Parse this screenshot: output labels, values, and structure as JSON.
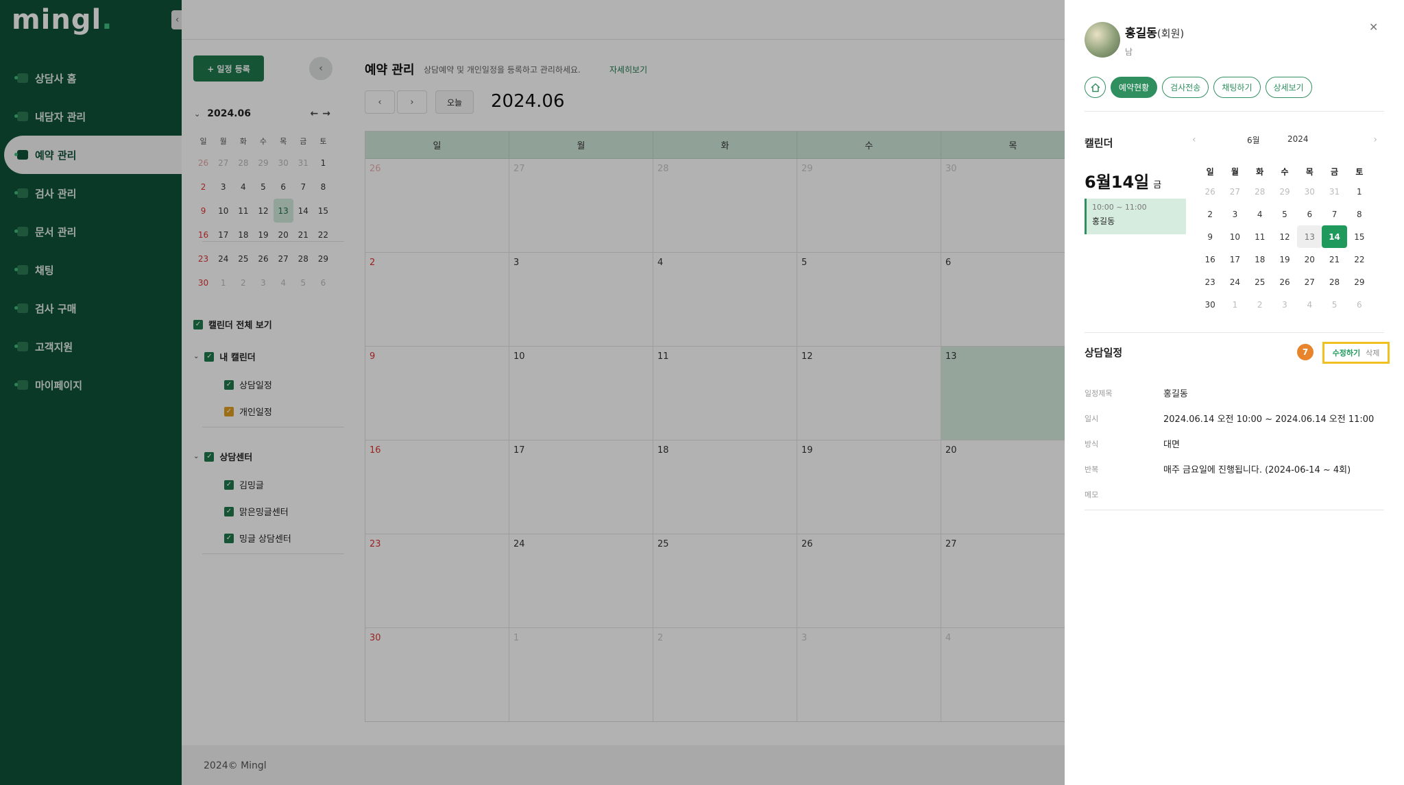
{
  "app": {
    "logo": "mingl",
    "logo_dot": "."
  },
  "sidebar": {
    "collapse_icon": "‹",
    "items": [
      {
        "label": "상담사 홈",
        "active": false
      },
      {
        "label": "내담자 관리",
        "active": false
      },
      {
        "label": "예약 관리",
        "active": true
      },
      {
        "label": "검사 관리",
        "active": false
      },
      {
        "label": "문서 관리",
        "active": false
      },
      {
        "label": "채팅",
        "active": false
      },
      {
        "label": "검사 구매",
        "active": false
      },
      {
        "label": "고객지원",
        "active": false
      },
      {
        "label": "마이페이지",
        "active": false
      }
    ]
  },
  "left_panel": {
    "add_button": "+ 일정 등록",
    "toggle_icon": "‹",
    "mini_calendar": {
      "month": "2024.06",
      "fold_icon": "⌄",
      "prev_icon": "←",
      "next_icon": "→",
      "weekdays": [
        "일",
        "월",
        "화",
        "수",
        "목",
        "금",
        "토"
      ],
      "weeks": [
        [
          "26",
          "27",
          "28",
          "29",
          "30",
          "31",
          "1"
        ],
        [
          "2",
          "3",
          "4",
          "5",
          "6",
          "7",
          "8"
        ],
        [
          "9",
          "10",
          "11",
          "12",
          "13",
          "14",
          "15"
        ],
        [
          "16",
          "17",
          "18",
          "19",
          "20",
          "21",
          "22"
        ],
        [
          "23",
          "24",
          "25",
          "26",
          "27",
          "28",
          "29"
        ],
        [
          "30",
          "1",
          "2",
          "3",
          "4",
          "5",
          "6"
        ]
      ],
      "selected": "13"
    },
    "view_all": "캘린더 전체 보기",
    "my_calendar": "내 캘린더",
    "consult_schedule": "상담일정",
    "personal_schedule": "개인일정",
    "center": "상담센터",
    "centers": [
      "김밍글",
      "맑은밍글센터",
      "밍글 상담센터"
    ],
    "check_icon": "✓"
  },
  "main": {
    "title": "예약 관리",
    "subtitle": "상담예약 및 개인일정을 등록하고 관리하세요.",
    "detail_link": "자세히보기",
    "prev_icon": "‹",
    "next_icon": "›",
    "today_label": "오늘",
    "month": "2024.06",
    "weekdays": [
      "일",
      "월",
      "화",
      "수",
      "목"
    ],
    "weeks": [
      [
        "26",
        "27",
        "28",
        "29",
        "30"
      ],
      [
        "2",
        "3",
        "4",
        "5",
        "6"
      ],
      [
        "9",
        "10",
        "11",
        "12",
        "13"
      ],
      [
        "16",
        "17",
        "18",
        "19",
        "20"
      ],
      [
        "23",
        "24",
        "25",
        "26",
        "27"
      ],
      [
        "30",
        "1",
        "2",
        "3",
        "4"
      ]
    ],
    "highlight": "13",
    "footer": "2024© Mingl"
  },
  "drawer": {
    "user_name": "홍길동",
    "user_role": "(회원)",
    "gender": "남",
    "close_icon": "✕",
    "tabs": [
      "예약현황",
      "검사전송",
      "채팅하기",
      "상세보기"
    ],
    "active_tab": "예약현황",
    "calendar_label": "캘린더",
    "selected_date": "6월14일",
    "selected_dow": "금",
    "event_time": "10:00 ~ 11:00",
    "event_name": "홍길동",
    "dm_prev": "‹",
    "dm_next": "›",
    "dm_month": "6월",
    "dm_year": "2024",
    "dm_weekdays": [
      "일",
      "월",
      "화",
      "수",
      "목",
      "금",
      "토"
    ],
    "dm_weeks": [
      [
        "26",
        "27",
        "28",
        "29",
        "30",
        "31",
        "1"
      ],
      [
        "2",
        "3",
        "4",
        "5",
        "6",
        "7",
        "8"
      ],
      [
        "9",
        "10",
        "11",
        "12",
        "13",
        "14",
        "15"
      ],
      [
        "16",
        "17",
        "18",
        "19",
        "20",
        "21",
        "22"
      ],
      [
        "23",
        "24",
        "25",
        "26",
        "27",
        "28",
        "29"
      ],
      [
        "30",
        "1",
        "2",
        "3",
        "4",
        "5",
        "6"
      ]
    ],
    "dm_today": "13",
    "dm_selected": "14",
    "schedule_title": "상담일정",
    "step_badge": "7",
    "edit_label": "수정하기",
    "delete_label": "삭제",
    "details": [
      {
        "key": "일정제목",
        "value": "홍길동"
      },
      {
        "key": "일시",
        "value": "2024.06.14 오전 10:00 ~ 2024.06.14 오전 11:00"
      },
      {
        "key": "방식",
        "value": "대면"
      },
      {
        "key": "반복",
        "value": "매주 금요일에 진행됩니다. (2024-06-14 ~ 4회)"
      },
      {
        "key": "메모",
        "value": ""
      }
    ]
  },
  "colors": {
    "brand": "#0f5238",
    "accent": "#1f9a5c",
    "highlight": "#f0c020",
    "badge": "#e8842c"
  }
}
